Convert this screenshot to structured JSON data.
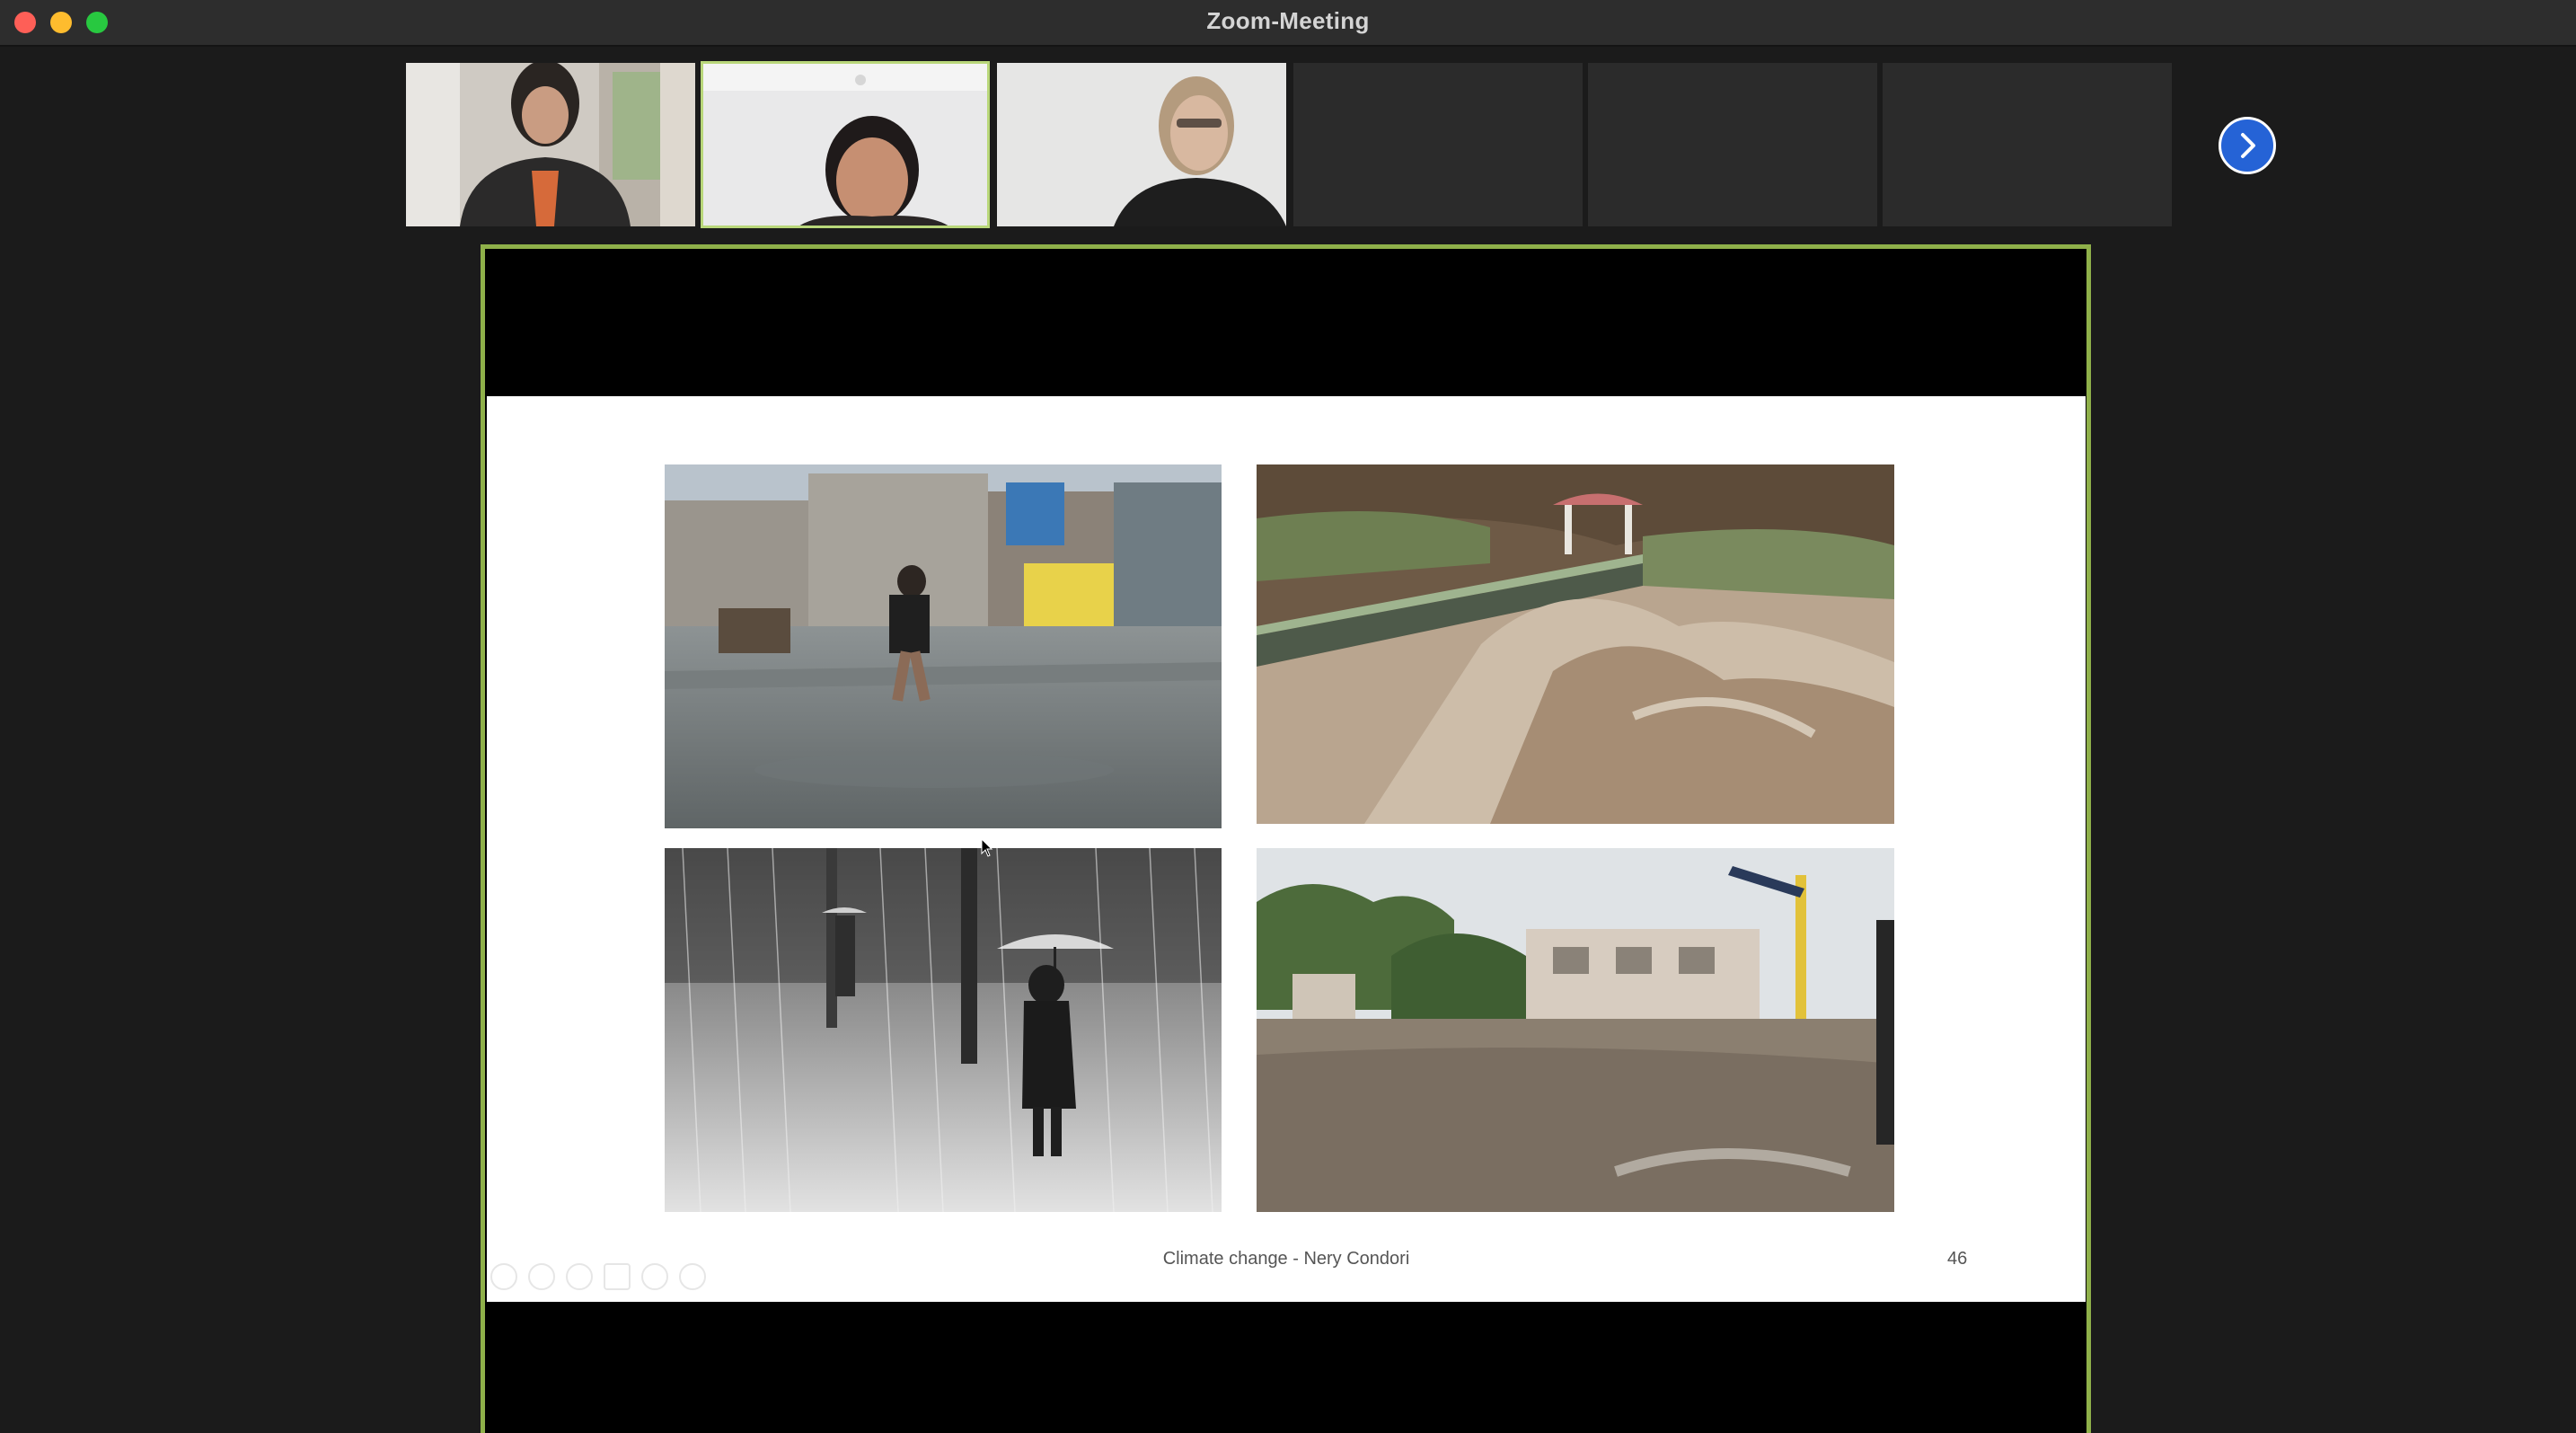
{
  "window": {
    "title": "Zoom-Meeting"
  },
  "colors": {
    "speaking_border": "#b9d77a",
    "share_border": "#8fb04a",
    "next_button": "#2563d6"
  },
  "participants": [
    {
      "state": "video"
    },
    {
      "state": "video",
      "speaking": true
    },
    {
      "state": "video"
    },
    {
      "state": "no-video"
    },
    {
      "state": "no-video"
    },
    {
      "state": "no-video"
    }
  ],
  "controls": {
    "next_page_icon": "chevron-right-icon"
  },
  "slide": {
    "footer": "Climate change  - Nery Condori",
    "page_number": "46",
    "photos": [
      "flooded-street-photo",
      "river-flood-bridge-photo",
      "heavy-rain-umbrella-photo",
      "flooded-town-photo"
    ],
    "toolbar_icons": [
      "prev-slide-icon",
      "next-slide-icon",
      "pen-icon",
      "slides-icon",
      "zoom-icon",
      "more-icon"
    ]
  }
}
